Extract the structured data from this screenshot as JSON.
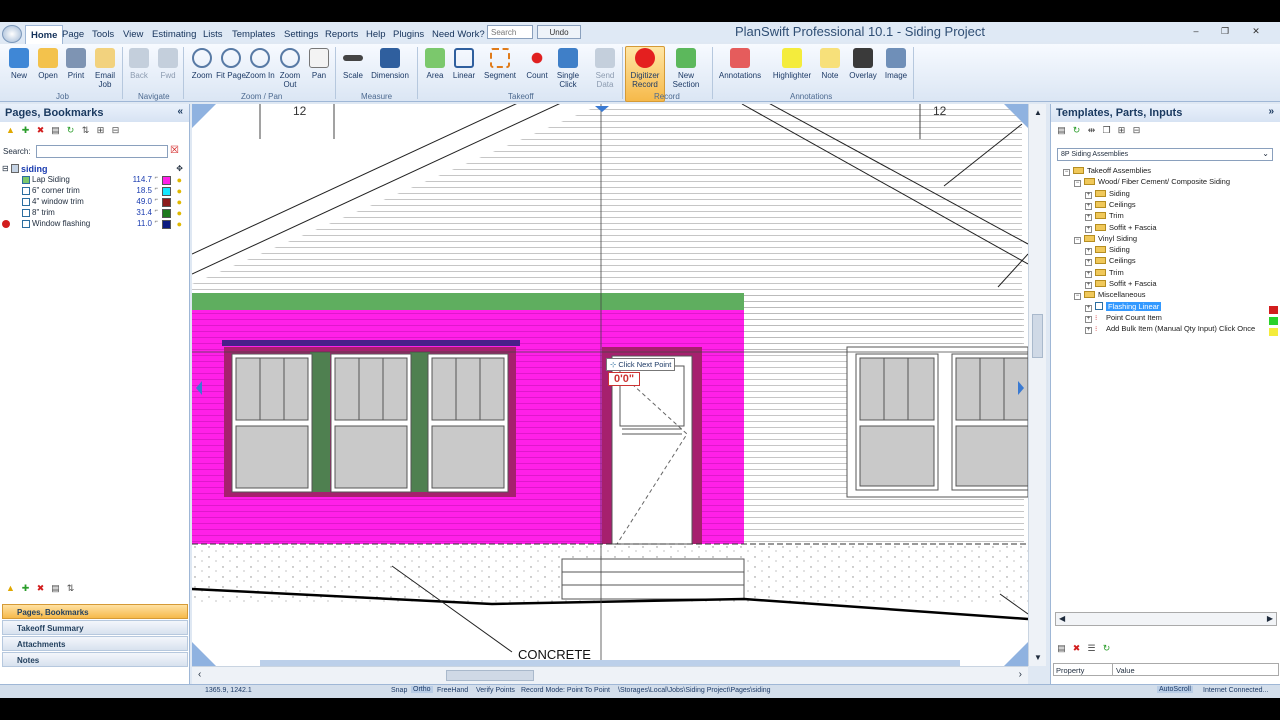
{
  "window": {
    "title": "PlanSwift Professional 10.1 - Siding Project"
  },
  "menu": [
    "Home",
    "Page",
    "Tools",
    "View",
    "Estimating",
    "Lists",
    "Templates",
    "Settings",
    "Reports",
    "Help",
    "Plugins",
    "Need Work?"
  ],
  "quick": {
    "search": "Search",
    "undo": "Undo"
  },
  "ribbon": {
    "buttons": [
      "New",
      "Open",
      "Print",
      "Email Job",
      "Back",
      "Fwd",
      "Zoom",
      "Fit Page",
      "Zoom In",
      "Zoom Out",
      "Pan",
      "Scale",
      "Dimension",
      "Area",
      "Linear",
      "Segment",
      "Count",
      "Single Click",
      "Send Data",
      "Digitizer Record",
      "New Section",
      "Annotations",
      "Highlighter",
      "Note",
      "Overlay",
      "Image"
    ],
    "groups": [
      "Job",
      "Navigate",
      "Zoom / Pan",
      "Measure",
      "Takeoff",
      "Record",
      "Annotations"
    ]
  },
  "left": {
    "header": "Pages, Bookmarks",
    "search_label": "Search:",
    "page_name": "siding",
    "items": [
      {
        "name": "Lap Siding",
        "qty": "114.7",
        "color": "#ff20e8"
      },
      {
        "name": "6\" corner trim",
        "qty": "18.5",
        "color": "#14e8ff"
      },
      {
        "name": "4\" window trim",
        "qty": "49.0",
        "color": "#8b1a1a"
      },
      {
        "name": "8\" trim",
        "qty": "31.4",
        "color": "#1d7a1d"
      },
      {
        "name": "Window flashing",
        "qty": "11.0",
        "color": "#0c1a80"
      }
    ],
    "accordion": [
      "Pages, Bookmarks",
      "Takeoff Summary",
      "Attachments",
      "Notes"
    ]
  },
  "drawing": {
    "dim_left": "12",
    "dim_right": "12",
    "tooltip": "Click Next Point",
    "measure": "0'0\"",
    "label": "CONCRETE"
  },
  "right": {
    "header": "Templates, Parts, Inputs",
    "dropdown": "8P Siding Assemblies",
    "tree": [
      "Takeoff Assemblies",
      "Wood/ Fiber Cement/ Composite Siding",
      "Siding",
      "Ceilings",
      "Trim",
      "Soffit + Fascia",
      "Vinyl Siding",
      "Siding",
      "Ceilings",
      "Trim",
      "Soffit + Fascia",
      "Miscellaneous",
      "Flashing Linear",
      "Point Count Item",
      "Add Bulk Item (Manual Qty Input) Click Once"
    ],
    "prop_col": "Property",
    "val_col": "Value"
  },
  "status": {
    "coords": "1365.9, 1242.1",
    "snap": "Snap",
    "ortho": "Ortho",
    "freehand": "FreeHand",
    "verify": "Verify Points",
    "mode": "Record Mode: Point To Point",
    "path": "\\Storages\\Local\\Jobs\\Siding Project\\Pages\\siding",
    "autoscroll": "AutoScroll",
    "internet": "Internet Connected..."
  }
}
